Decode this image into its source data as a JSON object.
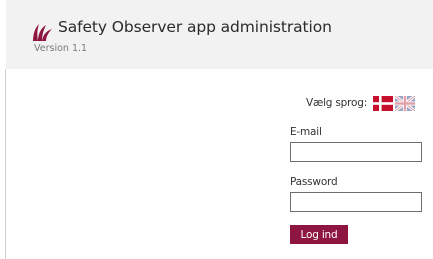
{
  "header": {
    "title": "Safety Observer app administration",
    "version": "Version 1.1",
    "logo_icon": "leaf-logo-icon",
    "logo_color": "#8e1540"
  },
  "language": {
    "label": "Vælg sprog:",
    "options": [
      {
        "icon": "danish-flag-icon",
        "language": "Danish"
      },
      {
        "icon": "uk-flag-icon",
        "language": "English"
      }
    ]
  },
  "login_form": {
    "email_label": "E-mail",
    "email_value": "",
    "password_label": "Password",
    "password_value": "",
    "submit_label": "Log ind"
  },
  "colors": {
    "accent": "#8e1540",
    "header_background": "#f2f2f2"
  }
}
